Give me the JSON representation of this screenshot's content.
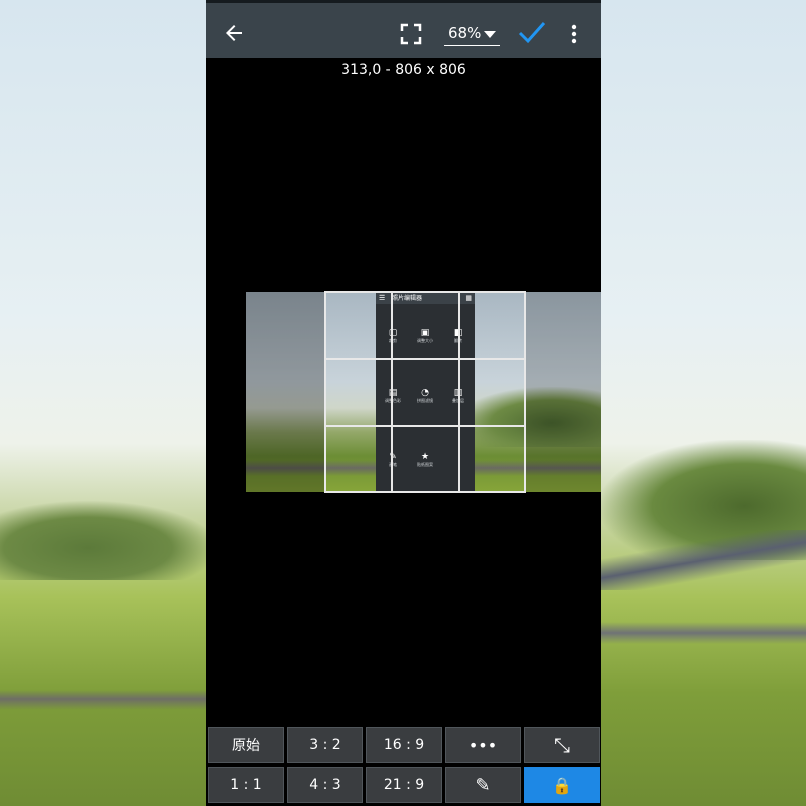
{
  "toolbar": {
    "zoom": "68%",
    "accent_color": "#1e88e5",
    "icons": [
      "back-arrow-icon",
      "fullscreen-icon",
      "check-icon",
      "more-vert-icon"
    ]
  },
  "crop_info": "313,0 - 806 x 806",
  "preview": {
    "app_title": "照片编辑器",
    "items": [
      {
        "icon": "▢",
        "label": "裁剪"
      },
      {
        "icon": "▣",
        "label": "调整大小"
      },
      {
        "icon": "◧",
        "label": "翻转"
      },
      {
        "icon": "▤",
        "label": "调整色彩"
      },
      {
        "icon": "◔",
        "label": "拼图滤镜"
      },
      {
        "icon": "▥",
        "label": "叠加层"
      },
      {
        "icon": "✎",
        "label": "画笔"
      },
      {
        "icon": "★",
        "label": "贴纸图案"
      }
    ]
  },
  "ratio_buttons": [
    {
      "label": "原始",
      "active": false
    },
    {
      "label": "3 : 2",
      "active": false
    },
    {
      "label": "16 : 9",
      "active": false
    },
    {
      "label": "•••",
      "active": false
    },
    {
      "label": "⤡",
      "active": false
    },
    {
      "label": "1 : 1",
      "active": false
    },
    {
      "label": "4 : 3",
      "active": false
    },
    {
      "label": "21 : 9",
      "active": false
    },
    {
      "label": "✎",
      "active": false
    },
    {
      "label": "🔒",
      "active": true
    }
  ]
}
